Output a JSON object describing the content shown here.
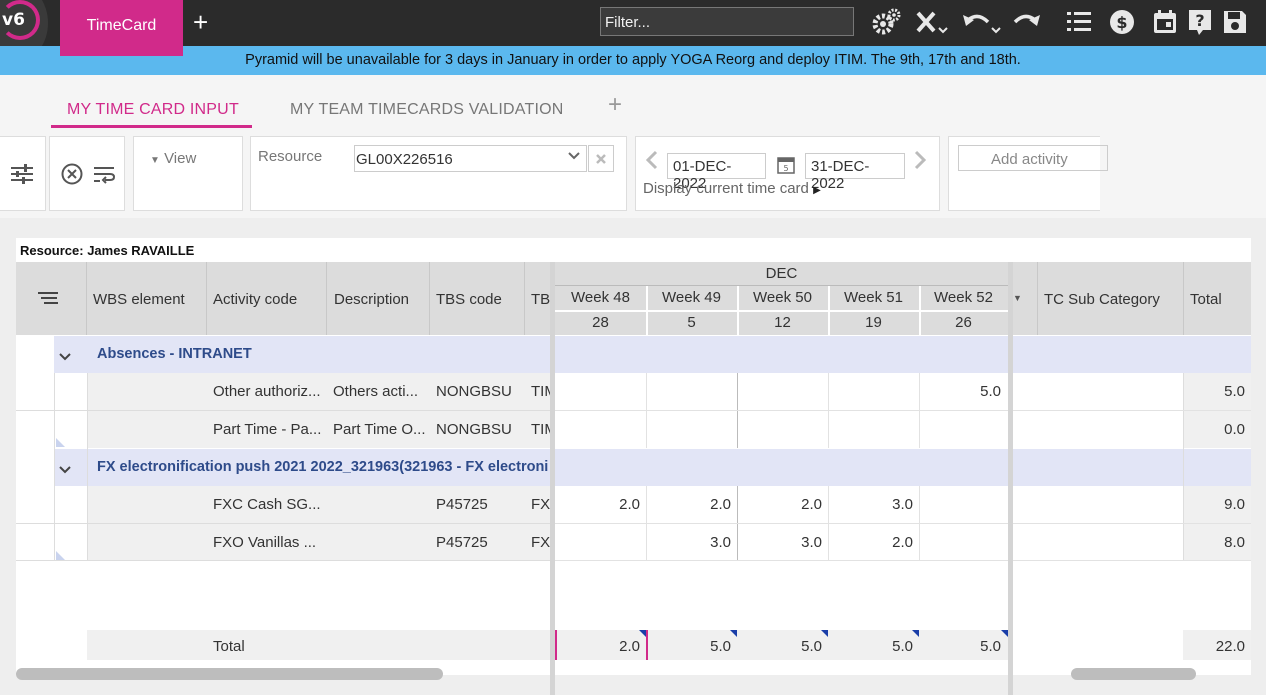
{
  "app": {
    "logo_text": "v6",
    "tab_label": "TimeCard",
    "add_tab": "+",
    "filter_placeholder": "Filter...",
    "icons": [
      "gears-icon",
      "clear-filter-icon",
      "undo-icon",
      "redo-icon",
      "list-icon",
      "currency-icon",
      "calendar-icon",
      "help-icon",
      "save-icon"
    ],
    "accent_color": "#d12a8a"
  },
  "banner": {
    "text": "Pyramid will be unavailable for 3 days in January in order to apply YOGA Reorg and deploy ITIM. The 9th, 17th and 18th."
  },
  "tabs": [
    {
      "label": "MY TIME CARD INPUT",
      "active": true
    },
    {
      "label": "MY TEAM TIMECARDS VALIDATION",
      "active": false
    }
  ],
  "tabs_add": "+",
  "toolbar": {
    "view_label": "View",
    "resource_label": "Resource",
    "resource_value": "GL00X226516",
    "start_date": "01-DEC-2022",
    "end_date": "31-DEC-2022",
    "calendar_day": "5",
    "display_current": "Display current time card",
    "add_activity_placeholder": "Add activity"
  },
  "grid": {
    "resource_title": "Resource: James RAVAILLE",
    "columns": {
      "wbs": "WBS element",
      "activity": "Activity code",
      "description": "Description",
      "tbs": "TBS code",
      "tb": "TB",
      "tc_sub": "TC Sub Category",
      "total": "Total"
    },
    "month": "DEC",
    "weeks": [
      {
        "label": "Week 48",
        "day": "28"
      },
      {
        "label": "Week 49",
        "day": "5"
      },
      {
        "label": "Week 50",
        "day": "12"
      },
      {
        "label": "Week 51",
        "day": "19"
      },
      {
        "label": "Week 52",
        "day": "26"
      }
    ],
    "groups": [
      {
        "label": "Absences - INTRANET",
        "rows": [
          {
            "activity": "Other authoriz...",
            "description": "Others acti...",
            "tbs": "NONGBSU",
            "tb": "TIM",
            "weeks": [
              "",
              "",
              "",
              "",
              "5.0"
            ],
            "total": "5.0"
          },
          {
            "activity": "Part Time - Pa...",
            "description": "Part Time O...",
            "tbs": "NONGBSU",
            "tb": "TIM",
            "weeks": [
              "",
              "",
              "",
              "",
              ""
            ],
            "total": "0.0"
          }
        ]
      },
      {
        "label": "FX electronification push 2021 2022_321963(321963 - FX electroni",
        "rows": [
          {
            "activity": "FXC Cash SG...",
            "description": "",
            "tbs": "P45725",
            "tb": "FXC",
            "weeks": [
              "2.0",
              "2.0",
              "2.0",
              "3.0",
              ""
            ],
            "total": "9.0"
          },
          {
            "activity": "FXO Vanillas ...",
            "description": "",
            "tbs": "P45725",
            "tb": "FXC",
            "weeks": [
              "",
              "3.0",
              "3.0",
              "2.0",
              ""
            ],
            "total": "8.0"
          }
        ]
      }
    ],
    "totals": {
      "label": "Total",
      "weeks": [
        "2.0",
        "5.0",
        "5.0",
        "5.0",
        "5.0"
      ],
      "grand": "22.0"
    }
  }
}
